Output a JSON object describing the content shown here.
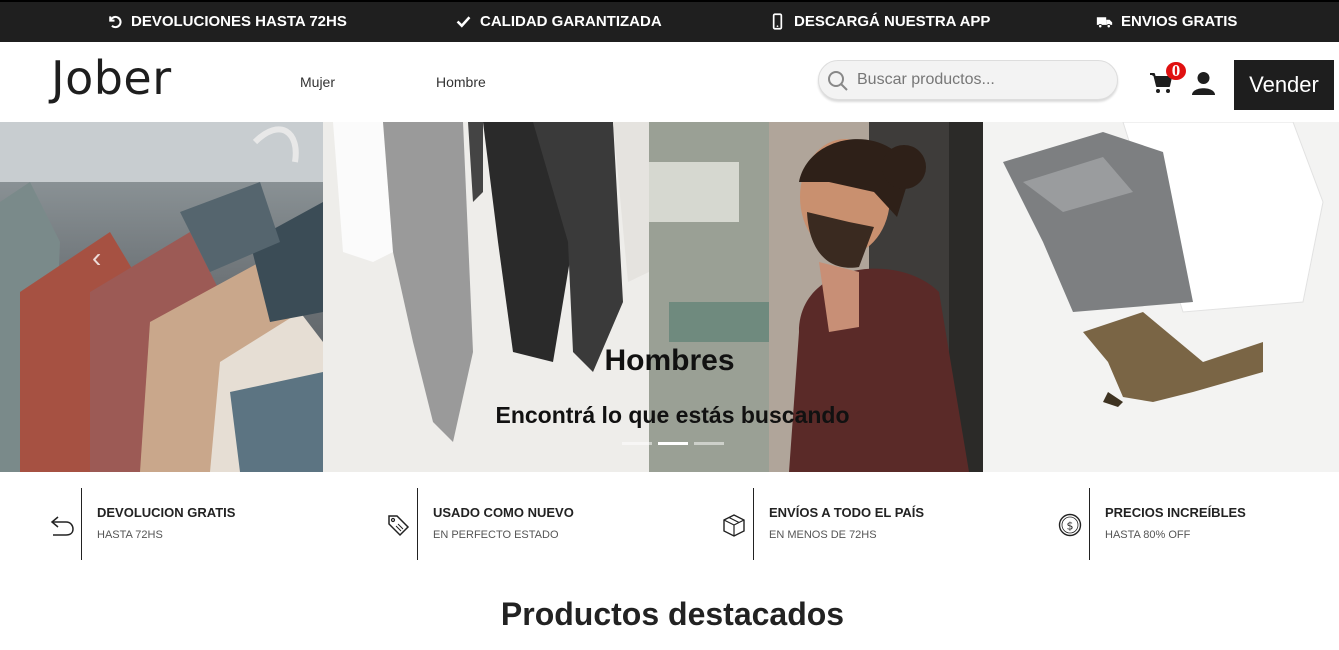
{
  "topbar": {
    "items": [
      {
        "icon": "undo-icon",
        "label": "DEVOLUCIONES HASTA 72HS"
      },
      {
        "icon": "check-icon",
        "label": "CALIDAD GARANTIZADA"
      },
      {
        "icon": "mobile-phone-icon",
        "label": "DESCARGÁ NUESTRA APP"
      },
      {
        "icon": "truck-icon",
        "label": "ENVIOS GRATIS"
      }
    ]
  },
  "header": {
    "logo": "Jober",
    "nav": [
      {
        "label": "Mujer"
      },
      {
        "label": "Hombre"
      }
    ],
    "search": {
      "placeholder": "Buscar productos..."
    },
    "cart_count": "0",
    "sell_label": "Vender"
  },
  "hero": {
    "title": "Hombres",
    "subtitle": "Encontrá lo que estás buscando",
    "slides": 3,
    "active_slide": 2
  },
  "features": [
    {
      "icon": "return-arrow-icon",
      "title": "DEVOLUCION GRATIS",
      "subtitle": "HASTA 72HS"
    },
    {
      "icon": "price-tag-icon",
      "title": "USADO COMO NUEVO",
      "subtitle": "EN PERFECTO ESTADO"
    },
    {
      "icon": "box-icon",
      "title": "ENVÍOS A TODO EL PAÍS",
      "subtitle": "EN MENOS DE 72HS"
    },
    {
      "icon": "dollar-coin-icon",
      "title": "PRECIOS INCREÍBLES",
      "subtitle": "HASTA 80% OFF"
    }
  ],
  "section": {
    "title": "Productos destacados"
  },
  "colors": {
    "topbar_bg": "#1f1f1f",
    "badge": "#e01010",
    "button_bg": "#1e1e1e"
  }
}
